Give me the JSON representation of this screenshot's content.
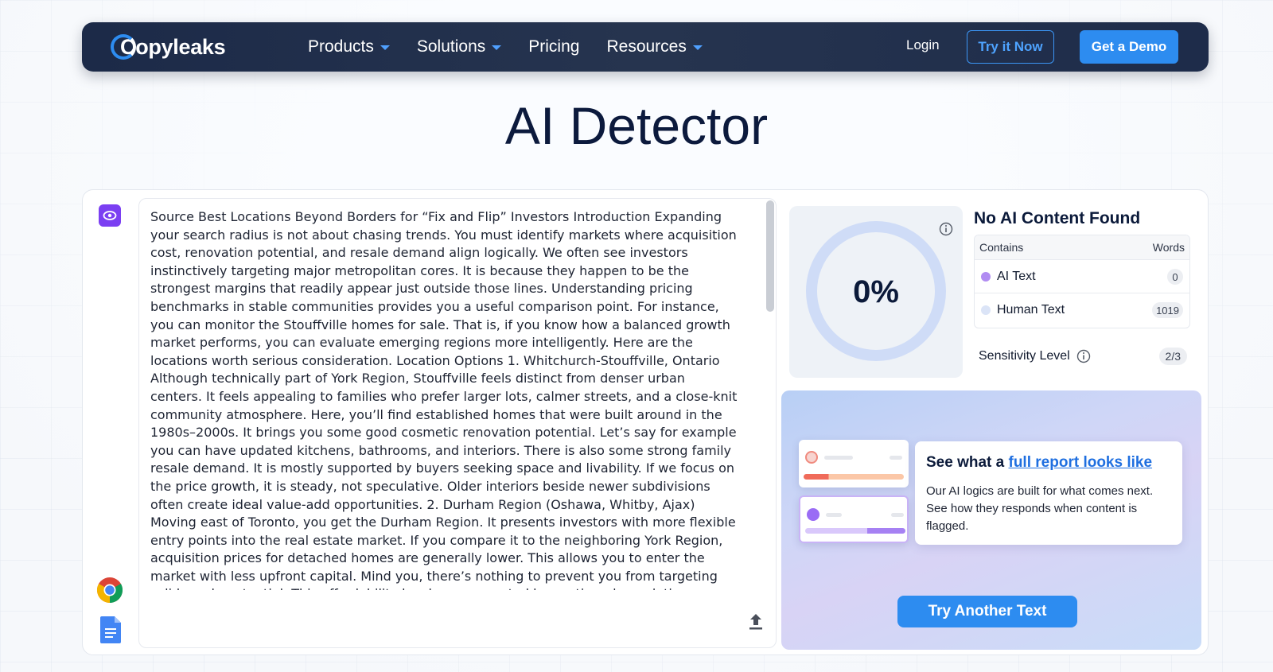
{
  "nav": {
    "brand": "Copyleaks",
    "links": [
      {
        "label": "Products",
        "dropdown": true
      },
      {
        "label": "Solutions",
        "dropdown": true
      },
      {
        "label": "Pricing",
        "dropdown": false
      },
      {
        "label": "Resources",
        "dropdown": true
      }
    ],
    "login": "Login",
    "try_now": "Try it Now",
    "get_demo": "Get a Demo"
  },
  "page": {
    "title": "AI Detector"
  },
  "input": {
    "text": "Source Best Locations Beyond Borders for “Fix and Flip” Investors Introduction Expanding your search radius is not about chasing trends. You must identify markets where acquisition cost, renovation potential, and resale demand align logically. We often see investors instinctively targeting major metropolitan cores. It is because they happen to be the strongest margins that readily appear just outside those lines. Understanding pricing benchmarks in stable communities provides you a useful comparison point. For instance, you can monitor the Stouffville homes for sale. That is, if you know how a balanced growth market performs, you can evaluate emerging regions more intelligently. Here are the locations worth serious consideration. Location Options 1. Whitchurch-Stouffville, Ontario Although technically part of York Region, Stouffville feels distinct from denser urban centers. It feels appealing to families who prefer larger lots, calmer streets, and a close-knit community atmosphere. Here, you’ll find established homes that were built around in the 1980s–2000s. It brings you some good cosmetic renovation potential. Let’s say for example you can have updated kitchens, bathrooms, and interiors. There is also some strong family resale demand. It is mostly supported by buyers seeking space and livability. If we focus on the price growth, it is steady, not speculative. Older interiors beside newer subdivisions often create ideal value-add opportunities. 2. Durham Region (Oshawa, Whitby, Ajax) Moving east of Toronto, you get the Durham Region. It presents investors with more flexible entry points into the real estate market. If you compare it to the neighboring York Region, acquisition prices for detached homes are generally lower. This allows you to enter the market with less upfront capital. Mind you, there’s nothing to prevent you from targeting solid resale potential. This affordability has been supported by continued population migration from higher-priced areas within the Greater Toronto Area. Because buyers search for"
  },
  "results": {
    "percent": "0%",
    "percent_value": 0,
    "title": "No AI Content Found",
    "table": {
      "col_contains": "Contains",
      "col_words": "Words",
      "rows": [
        {
          "label": "AI Text",
          "count": "0",
          "color": "#b18cf2"
        },
        {
          "label": "Human Text",
          "count": "1019",
          "color": "#dbe4f7"
        }
      ]
    },
    "sensitivity_label": "Sensitivity Level",
    "sensitivity_value": "2/3"
  },
  "promo": {
    "head_prefix": "See what a ",
    "head_link": "full report looks like",
    "description": "Our AI logics are built for what comes next. See how they responds when content is flagged.",
    "button": "Try Another Text"
  },
  "colors": {
    "accent": "#2d8cf0",
    "nav_bg": "#1c2a48",
    "ai": "#b18cf2",
    "human": "#dbe4f7"
  }
}
